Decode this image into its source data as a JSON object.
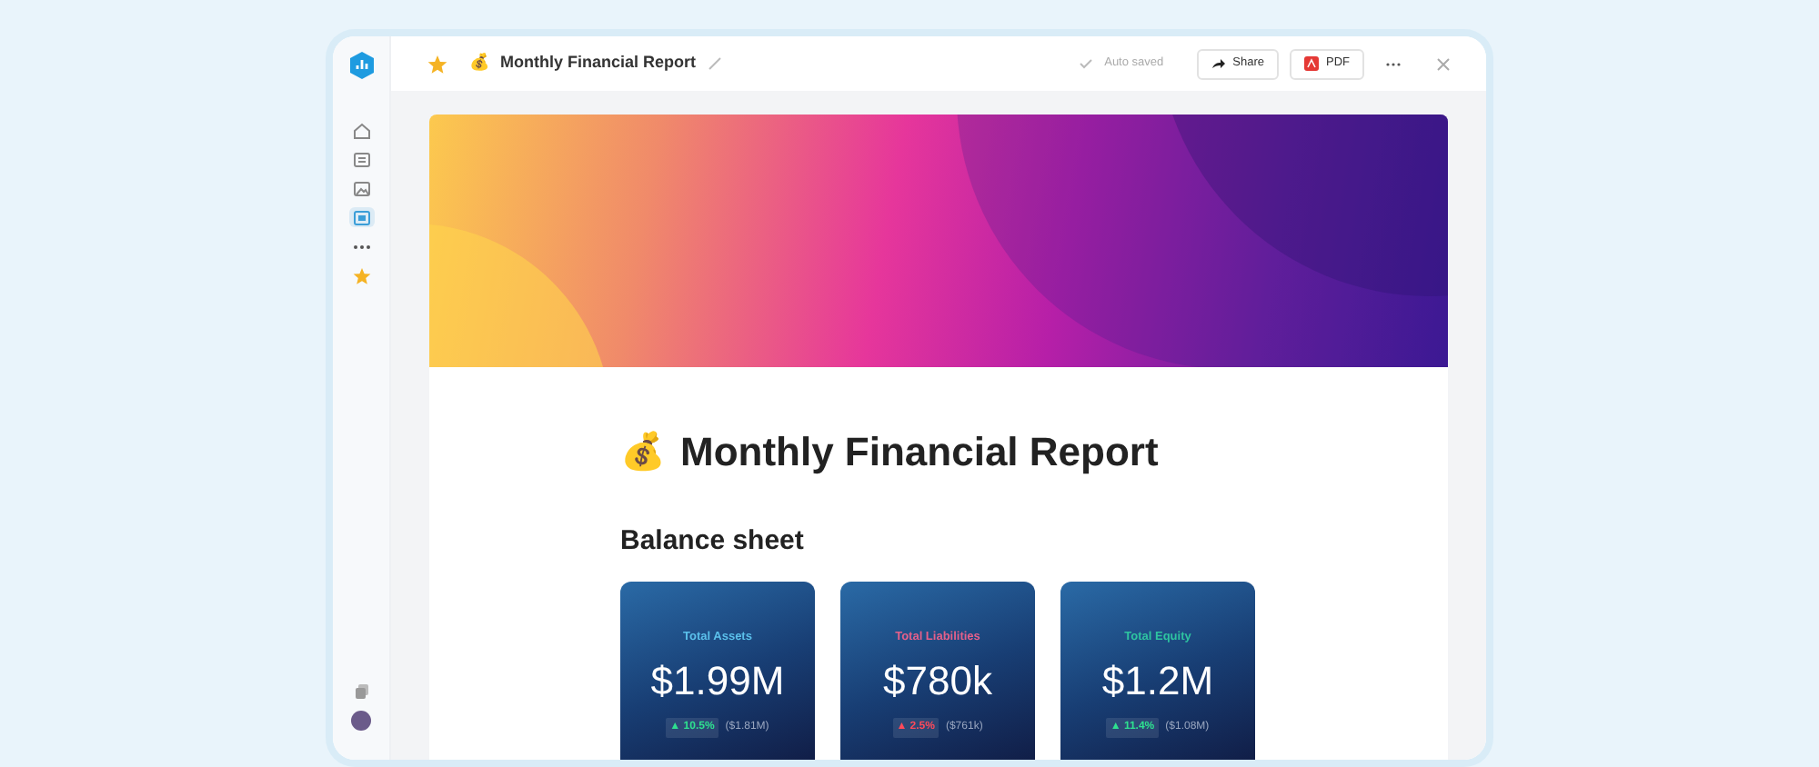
{
  "sidebar": {
    "items": [
      {
        "kind": "home",
        "selected": false
      },
      {
        "kind": "document",
        "selected": false
      },
      {
        "kind": "image",
        "selected": false
      },
      {
        "kind": "page",
        "selected": true
      },
      {
        "kind": "more",
        "selected": false
      },
      {
        "kind": "star",
        "selected": false
      }
    ]
  },
  "toolbar": {
    "starred": true,
    "emoji": "💰",
    "title": "Monthly Financial Report",
    "status": "Auto saved",
    "buttons": [
      {
        "kind": "share",
        "label": "Share"
      },
      {
        "kind": "pdf",
        "label": "PDF"
      }
    ]
  },
  "document": {
    "emoji": "💰",
    "title": "Monthly Financial Report",
    "section": "Balance sheet",
    "cards": [
      {
        "label": "Total Assets",
        "color": "#5bc0eb",
        "value": "$1.99M",
        "delta": {
          "text": "▲ 10.5%",
          "color": "#2ee08f"
        },
        "previous": "($1.81M)"
      },
      {
        "label": "Total Liabilities",
        "color": "#e5608a",
        "value": "$780k",
        "delta": {
          "text": "▲ 2.5%",
          "color": "#ff4a5a"
        },
        "previous": "($761k)"
      },
      {
        "label": "Total Equity",
        "color": "#2ec4a0",
        "value": "$1.2M",
        "delta": {
          "text": "▲ 11.4%",
          "color": "#2ee08f"
        },
        "previous": "($1.08M)"
      }
    ]
  }
}
